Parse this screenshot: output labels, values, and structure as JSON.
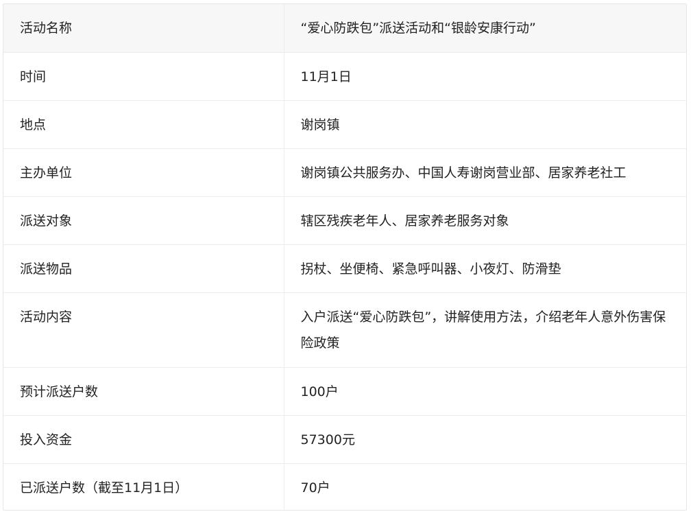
{
  "table": {
    "rows": [
      {
        "label": "活动名称",
        "value": "“爱心防跌包”派送活动和“银龄安康行动”"
      },
      {
        "label": "时间",
        "value": "11月1日"
      },
      {
        "label": "地点",
        "value": "谢岗镇"
      },
      {
        "label": "主办单位",
        "value": "谢岗镇公共服务办、中国人寿谢岗营业部、居家养老社工"
      },
      {
        "label": "派送对象",
        "value": "辖区残疾老年人、居家养老服务对象"
      },
      {
        "label": "派送物品",
        "value": "拐杖、坐便椅、紧急呼叫器、小夜灯、防滑垫"
      },
      {
        "label": "活动内容",
        "value": "入户派送“爱心防跌包”，讲解使用方法，介绍老年人意外伤害保险政策"
      },
      {
        "label": "预计派送户数",
        "value": "100户"
      },
      {
        "label": "投入资金",
        "value": "57300元"
      },
      {
        "label": "已派送户数（截至11月1日）",
        "value": "70户"
      }
    ]
  }
}
